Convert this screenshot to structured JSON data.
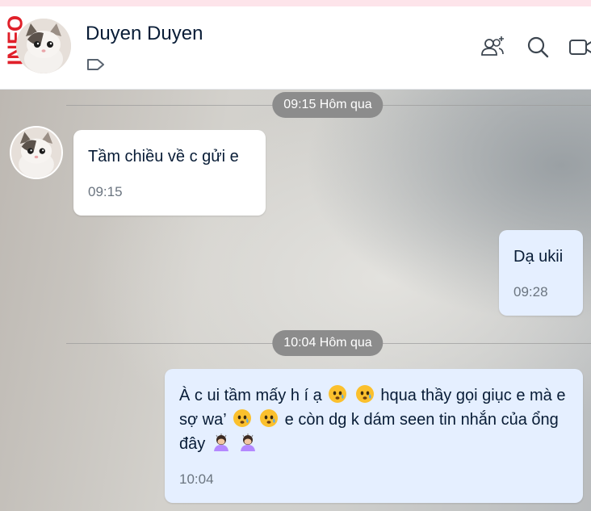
{
  "header": {
    "info_label": "INFO",
    "contact_name": "Duyen Duyen",
    "icons": [
      "tag-icon",
      "add-group-icon",
      "search-icon",
      "video-call-icon"
    ]
  },
  "dividers": [
    {
      "label": "09:15 Hôm qua"
    },
    {
      "label": "10:04 Hôm qua"
    }
  ],
  "messages": [
    {
      "direction": "incoming",
      "text": "Tầm chiều về c gửi e",
      "time": "09:15"
    },
    {
      "direction": "outgoing",
      "text": "Dạ ukii",
      "time": "09:28"
    },
    {
      "direction": "outgoing",
      "time": "10:04",
      "segments": [
        "À c ui tầm mấy h í ạ",
        "hqua thầy gọi giục e",
        "mà e sợ wa’",
        "e còn dg k dám seen tin",
        "nhắn của ổng đây"
      ],
      "emojis": [
        "worried-face-emoji",
        "person-bowing-emoji"
      ]
    }
  ],
  "colors": {
    "incoming_bubble": "#ffffff",
    "outgoing_bubble": "#e5efff",
    "text": "#081c36",
    "time_pill": "#8c8c8c",
    "info_red": "#e0202a"
  }
}
